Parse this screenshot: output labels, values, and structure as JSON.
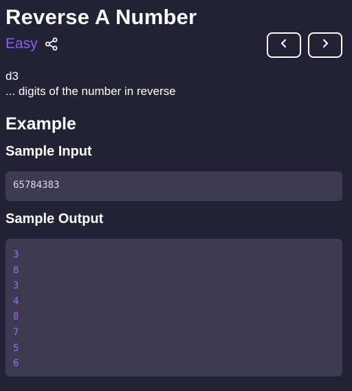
{
  "problem": {
    "title": "Reverse A Number",
    "difficulty": "Easy",
    "description_line1": "d3",
    "description_line2": "... digits of the number in reverse"
  },
  "sections": {
    "example_heading": "Example",
    "sample_input_heading": "Sample Input",
    "sample_output_heading": "Sample Output"
  },
  "sample_input": "65784383",
  "sample_output": [
    "3",
    "8",
    "3",
    "4",
    "8",
    "7",
    "5",
    "6"
  ],
  "icons": {
    "share": "share-icon",
    "prev": "chevron-left-icon",
    "next": "chevron-right-icon"
  },
  "colors": {
    "background": "#222235",
    "accent": "#8e5cf0",
    "code_background": "#3d3a52",
    "output_text": "#9b6cf2"
  }
}
